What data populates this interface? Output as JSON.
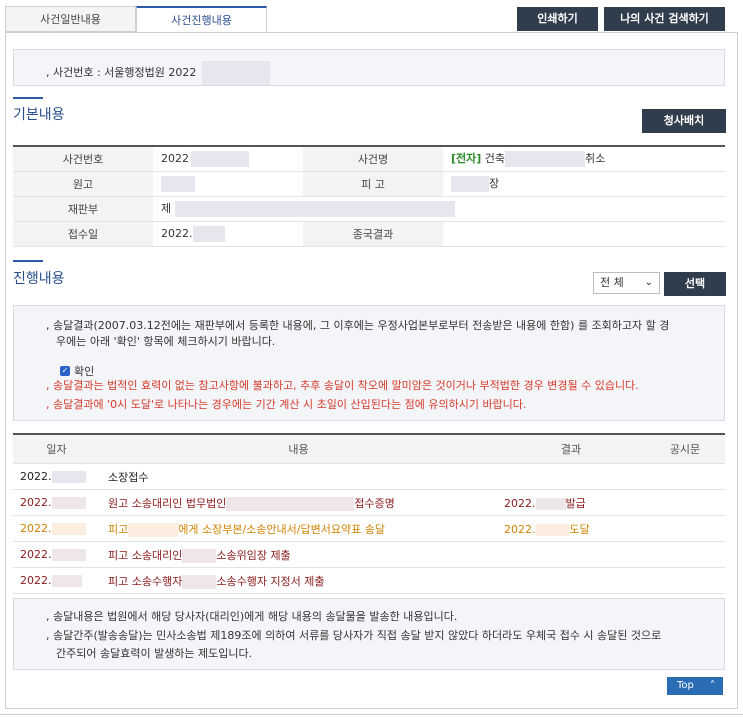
{
  "tabs": [
    {
      "label": "사건일반내용",
      "active": false
    },
    {
      "label": "사건진행내용",
      "active": true
    }
  ],
  "top_buttons": {
    "print": "인쇄하기",
    "my_search": "나의 사건 검색하기"
  },
  "case_number_line": "사건번호 : 서울행정법원 2022",
  "basic": {
    "title": "기본내용",
    "button": "청사배치",
    "labels": {
      "case_no": "사건번호",
      "case_name": "사건명",
      "plaintiff": "원고",
      "defendant": "피 고",
      "court": "재판부",
      "received": "접수일",
      "final": "종국결과"
    },
    "values": {
      "case_no": "2022",
      "case_name_tag": "[전자]",
      "case_name_prefix": "건축",
      "case_name_suffix": "취소",
      "defendant_suffix": "장",
      "court_prefix": "제",
      "received": "2022."
    }
  },
  "progress": {
    "title": "진행내용",
    "filter_value": "전 체",
    "select_button": "선택",
    "notice_1a": "송달결과(2007.03.12전에는 재판부에서 등록한 내용에, 그 이후에는 우정사업본부로부터 전송받은 내용에 한함) 를 조회하고자 할 경",
    "notice_1b": "우에는 아래 '확인' 항목에 체크하시기 바랍니다.",
    "check_label": "확인",
    "notice_2": "송달결과는 법적인 효력이 없는 참고사항에 불과하고, 추후 송달이 착오에 말미암은 것이거나 부적법한 경우 변경될 수 있습니다.",
    "notice_3": "송달결과에 '0시 도달'로 나타나는 경우에는 기간 계산 시 초일이 산입된다는 점에 유의하시기 바랍니다.",
    "columns": [
      "일자",
      "내용",
      "결과",
      "공시문"
    ],
    "rows": [
      {
        "date": "2022.",
        "content_a": "소장접수",
        "content_b": "",
        "result_a": "",
        "result_b": "",
        "style": "dark"
      },
      {
        "date": "2022.",
        "content_a": "원고 소송대리인 법무법인",
        "content_b": "접수증명",
        "result_a": "2022.",
        "result_b": "발급",
        "style": "maroon"
      },
      {
        "date": "2022.",
        "content_a": "피고",
        "content_b": "에게 소장부본/소송안내서/답변서요약표 송달",
        "result_a": "2022.",
        "result_b": "도달",
        "style": "orange"
      },
      {
        "date": "2022.",
        "content_a": "피고 소송대리인",
        "content_b": "소송위임장 제출",
        "result_a": "",
        "result_b": "",
        "style": "maroon"
      },
      {
        "date": "2022.",
        "content_a": "피고 소송수행자",
        "content_b": "소송수행자 지정서 제출",
        "result_a": "",
        "result_b": "",
        "style": "maroon"
      }
    ]
  },
  "footer": {
    "note_1": "송달내용은 법원에서 해당 당사자(대리인)에게 해당 내용의 송달물을 발송한 내용입니다.",
    "note_2a": "송달간주(발송송달)는 민사소송법 제189조에 의하여 서류를 당사자가 직접 송달 받지 않았다 하더라도 우체국 접수 시 송달된 것으로",
    "note_2b": "간주되어 송달효력이 발생하는 제도입니다.",
    "top_label": "Top"
  }
}
